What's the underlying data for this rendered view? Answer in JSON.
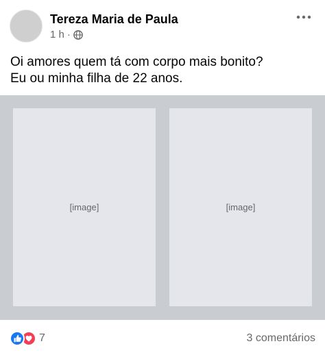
{
  "post": {
    "author": "Tereza Maria de Paula",
    "time": "1 h",
    "separator": "·",
    "privacy_icon": "globe-icon",
    "more_icon": "more-dots-icon",
    "text_lines": [
      "Oi amores quem tá com corpo mais bonito?",
      "Eu ou minha filha de 22 anos."
    ]
  },
  "media": {
    "left_placeholder": "[image]",
    "right_placeholder": "[image]"
  },
  "footer": {
    "reaction_icons": [
      "like-icon",
      "love-icon"
    ],
    "reaction_count": "7",
    "comments": "3 comentários"
  },
  "colors": {
    "like": "#1877f2",
    "love": "#f33e58",
    "meta_text": "#65676b"
  }
}
